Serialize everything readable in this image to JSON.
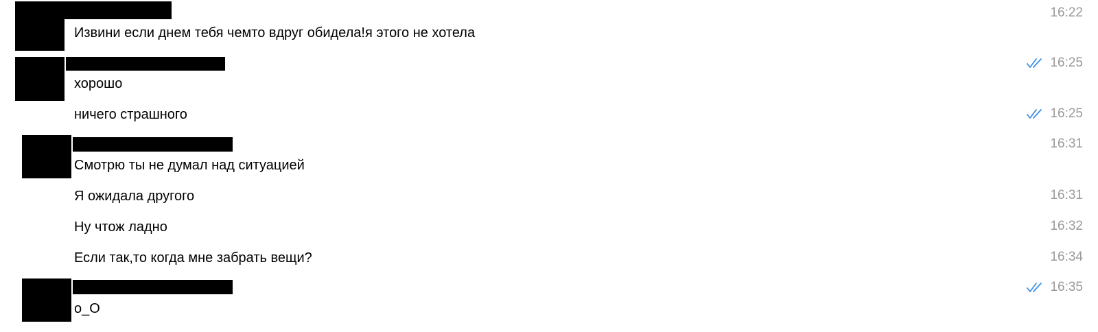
{
  "conversation": {
    "accent_color": "#3d8ee8",
    "messages": [
      {
        "text": "Извини если днем тебя чемто вдруг обидела!я этого не хотела",
        "time": "16:22",
        "read": false
      },
      {
        "text": "хорошо",
        "time": "16:25",
        "read": true
      },
      {
        "text": "ничего страшного",
        "time": "16:25",
        "read": true
      },
      {
        "text": "Смотрю ты не думал над ситуацией",
        "time": "16:31",
        "read": false
      },
      {
        "text": "Я ожидала другого",
        "time": "16:31",
        "read": false
      },
      {
        "text": "Ну чтож ладно",
        "time": "16:32",
        "read": false
      },
      {
        "text": "Если так,то когда мне забрать вещи?",
        "time": "16:34",
        "read": false
      },
      {
        "text": "o_O",
        "time": "16:35",
        "read": true
      }
    ],
    "status_icons": {
      "read": "double-check-icon"
    }
  }
}
